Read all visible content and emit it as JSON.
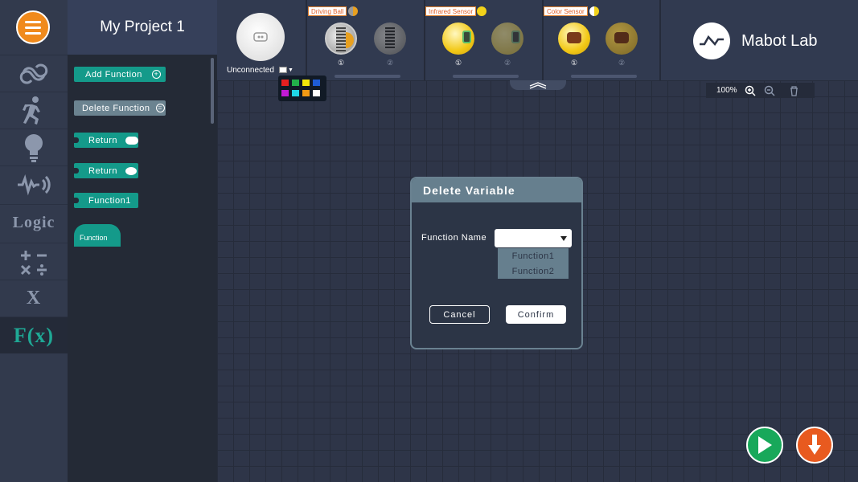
{
  "project": {
    "title": "My Project 1"
  },
  "rail": {
    "categories": [
      {
        "name": "loop",
        "icon": "loop-icon"
      },
      {
        "name": "motion",
        "icon": "running-figure-icon"
      },
      {
        "name": "light",
        "icon": "lightbulb-icon"
      },
      {
        "name": "sound",
        "icon": "soundwave-icon"
      },
      {
        "name": "logic",
        "label": "Logic"
      },
      {
        "name": "math",
        "icon": "math-operators-icon"
      },
      {
        "name": "variable",
        "label": "X"
      },
      {
        "name": "function",
        "label": "F(x)",
        "active": true
      }
    ]
  },
  "palette": {
    "add_function": "Add Function",
    "delete_function": "Delete Function",
    "blocks": [
      "Return",
      "Return",
      "Function1",
      "Function"
    ]
  },
  "hub": {
    "status": "Unconnected",
    "color_options": [
      "#e52020",
      "#22b04a",
      "#f2e60a",
      "#1e5cd6",
      "#c21ad6",
      "#1fd6e6",
      "#f29a14",
      "#ffffff"
    ]
  },
  "modules": [
    {
      "label": "Driving Ball",
      "tag_color": "#e8a020",
      "devices": [
        "①",
        "②"
      ]
    },
    {
      "label": "Infrared Sensor",
      "tag_color": "#f2d21a",
      "devices": [
        "①",
        "②"
      ]
    },
    {
      "label": "Color Sensor",
      "tag_color": "#f2d21a",
      "devices": [
        "①",
        "②"
      ]
    }
  ],
  "brand": {
    "name": "Mabot Lab"
  },
  "zoom": {
    "level": "100%"
  },
  "dialog": {
    "title": "Delete Variable",
    "field_label": "Function Name",
    "select_value": "",
    "options": [
      "Function1",
      "Function2"
    ],
    "cancel": "Cancel",
    "confirm": "Confirm"
  },
  "colors": {
    "accent": "#149a8a",
    "orange": "#f08a1c",
    "run": "#18a85a",
    "download": "#e85a1f"
  }
}
